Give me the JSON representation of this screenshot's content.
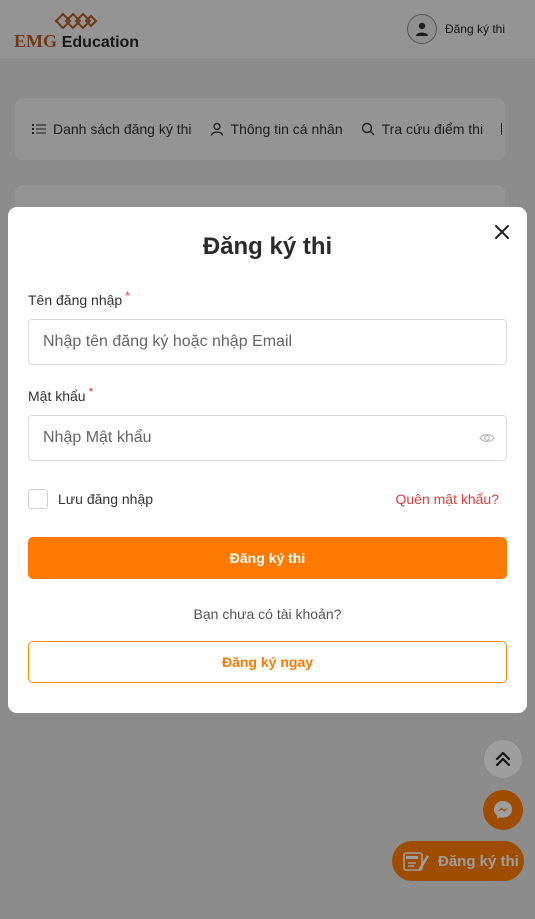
{
  "header": {
    "logo_emg": "EMG",
    "logo_education": "Education",
    "user_label": "Đăng ký thi",
    "colors": {
      "logo_orange": "#c0622a"
    }
  },
  "tabs": [
    {
      "label": "Danh sách đăng ký thi",
      "icon": "list-icon"
    },
    {
      "label": "Thông tin cá nhân",
      "icon": "user-icon"
    },
    {
      "label": "Tra cứu điểm thi",
      "icon": "search-icon"
    }
  ],
  "modal": {
    "title": "Đăng ký thi",
    "username": {
      "label": "Tên đăng nhập",
      "required_mark": "*",
      "placeholder": "Nhập tên đăng ký hoặc nhập Email",
      "value": ""
    },
    "password": {
      "label": "Mật khẩu",
      "required_mark": "*",
      "placeholder": "Nhập Mật khẩu",
      "value": ""
    },
    "remember_label": "Lưu đăng nhập",
    "remember_checked": false,
    "forgot_label": "Quên mật khẩu?",
    "submit_label": "Đăng ký thi",
    "no_account_text": "Bạn chưa có tài khoản?",
    "register_now_label": "Đăng ký ngay"
  },
  "floating": {
    "register_label": "Đăng ký thi",
    "icons": [
      "chevrons-up-icon",
      "messenger-icon",
      "exam-pencil-icon"
    ]
  },
  "colors": {
    "accent": "#ff7a00",
    "danger": "#e03c3c",
    "overlay": "rgba(0,0,0,0.42)"
  }
}
